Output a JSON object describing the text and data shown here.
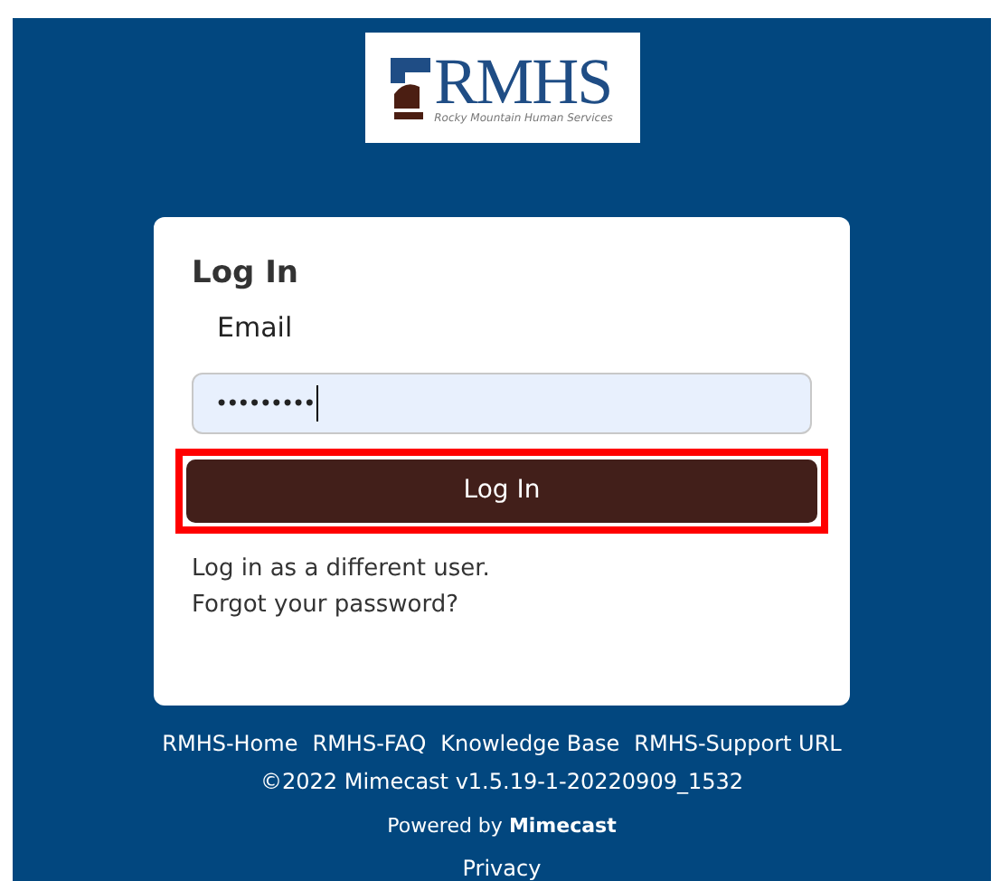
{
  "logo": {
    "title": "RMHS",
    "subtitle": "Rocky Mountain Human Services"
  },
  "card": {
    "heading": "Log In",
    "email_label": "Email",
    "password": {
      "value": "•••••••••",
      "focused": true
    },
    "login_button": {
      "label": "Log In",
      "highlighted": true
    },
    "links": [
      "Log in as a different user.",
      "Forgot your password?"
    ]
  },
  "footer": {
    "links": [
      "RMHS-Home",
      "RMHS-FAQ",
      "Knowledge Base",
      "RMHS-Support URL"
    ],
    "version": "©2022 Mimecast v1.5.19-1-20220909_1532",
    "powered_by": "Powered by **Mimecast**",
    "privacy": "Privacy"
  }
}
